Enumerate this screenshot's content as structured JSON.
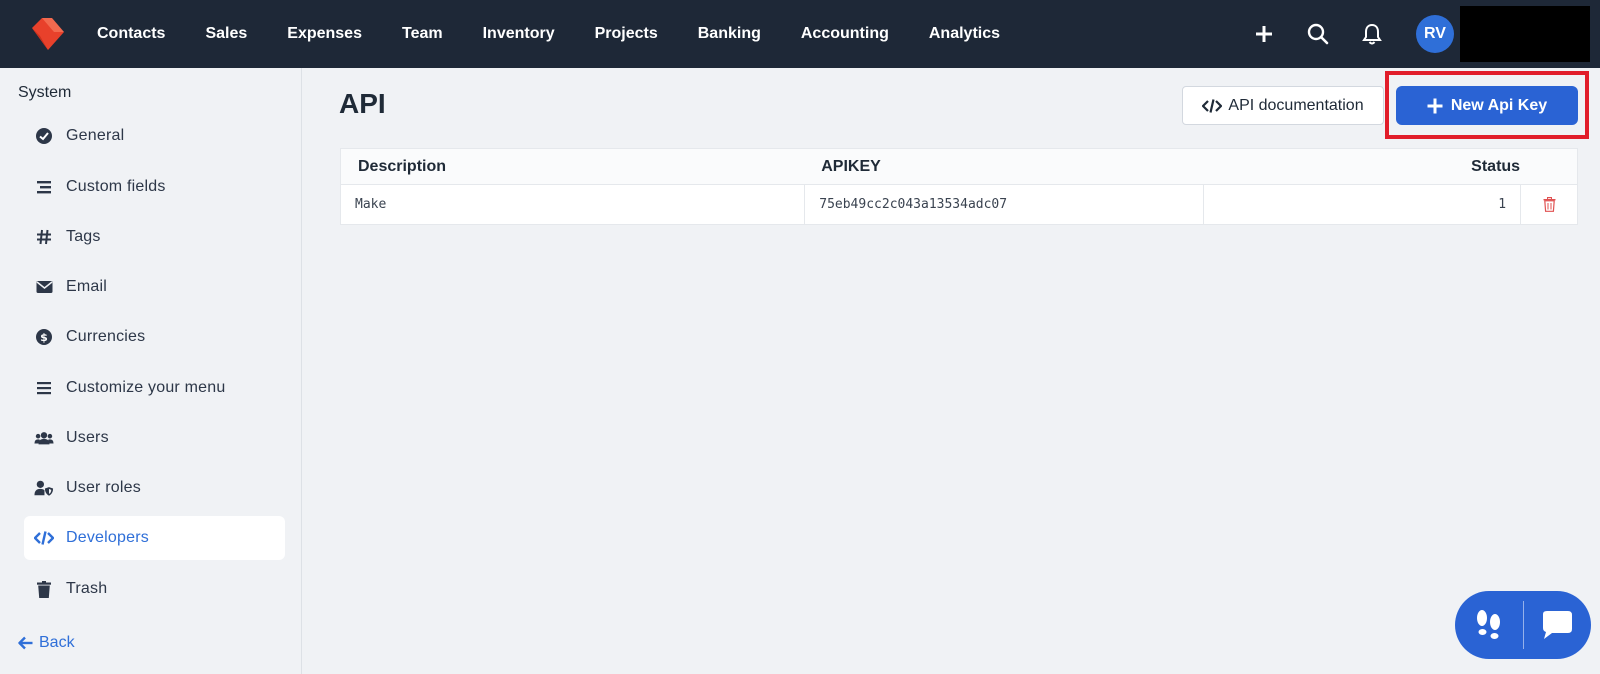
{
  "nav": {
    "items": [
      "Contacts",
      "Sales",
      "Expenses",
      "Team",
      "Inventory",
      "Projects",
      "Banking",
      "Accounting",
      "Analytics"
    ],
    "avatar_initials": "RV"
  },
  "sidebar": {
    "heading": "System",
    "items": [
      {
        "label": "General",
        "icon": "check-circle-icon"
      },
      {
        "label": "Custom fields",
        "icon": "list-icon"
      },
      {
        "label": "Tags",
        "icon": "hashtag-icon"
      },
      {
        "label": "Email",
        "icon": "envelope-icon"
      },
      {
        "label": "Currencies",
        "icon": "dollar-circle-icon"
      },
      {
        "label": "Customize your menu",
        "icon": "menu-icon"
      },
      {
        "label": "Users",
        "icon": "users-icon"
      },
      {
        "label": "User roles",
        "icon": "user-shield-icon"
      },
      {
        "label": "Developers",
        "icon": "code-icon",
        "active": true
      },
      {
        "label": "Trash",
        "icon": "trash-icon"
      }
    ],
    "back_label": "Back"
  },
  "main": {
    "title": "API",
    "doc_button": "API documentation",
    "new_button": "New Api Key",
    "table": {
      "headers": [
        "Description",
        "APIKEY",
        "Status"
      ],
      "rows": [
        {
          "description": "Make",
          "apikey": "75eb49cc2c043a13534adc07",
          "status": "1"
        }
      ]
    }
  },
  "colors": {
    "topbar": "#1e2837",
    "accent": "#2a63d4",
    "highlight": "#e11d2a",
    "delete": "#e05252"
  }
}
